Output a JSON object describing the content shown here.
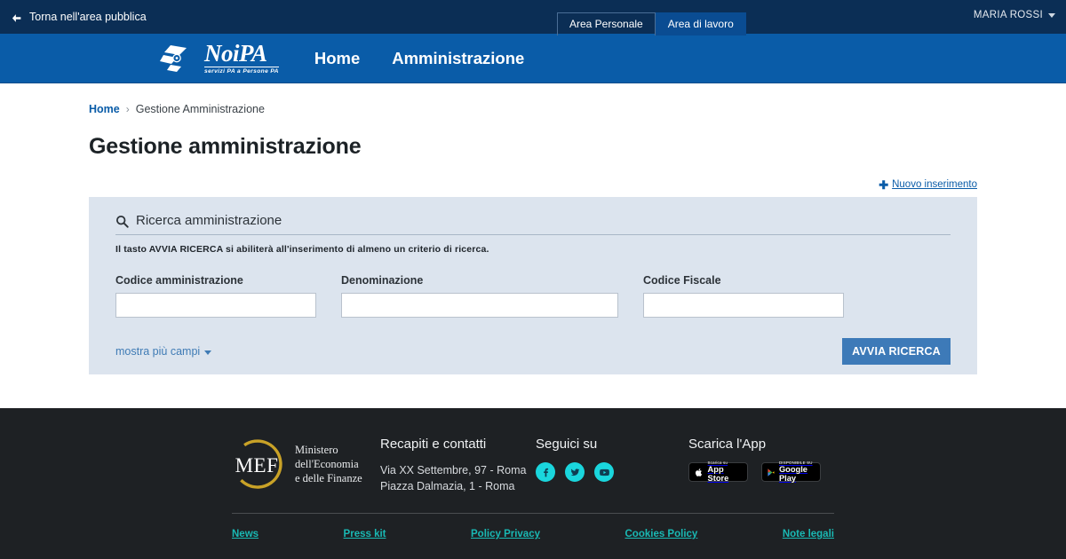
{
  "topbar": {
    "back_label": "Torna nell'area pubblica",
    "back_icon": "arrow-left-icon",
    "tabs": [
      {
        "label": "Area Personale",
        "active": false
      },
      {
        "label": "Area di lavoro",
        "active": true
      }
    ],
    "user": "MARIA ROSSI",
    "user_caret_icon": "chevron-down-icon",
    "bg_color": "#0b2e55"
  },
  "header": {
    "logo_text": "NoiPA",
    "logo_tagline": "servizi PA a Persone PA",
    "nav": [
      {
        "label": "Home"
      },
      {
        "label": "Amministrazione"
      }
    ],
    "bg_color": "#0a5ca8"
  },
  "breadcrumb": {
    "home": "Home",
    "separator": "›",
    "current": "Gestione Amministrazione"
  },
  "page": {
    "title": "Gestione amministrazione",
    "new_insert_label": "Nuovo inserimento",
    "new_insert_icon": "plus-icon"
  },
  "search_panel": {
    "search_icon": "search-icon",
    "title": "Ricerca amministrazione",
    "hint": "Il tasto AVVIA RICERCA si abiliterà all'inserimento di almeno un criterio di ricerca.",
    "fields": [
      {
        "label": "Codice amministrazione",
        "value": "",
        "placeholder": ""
      },
      {
        "label": "Denominazione",
        "value": "",
        "placeholder": ""
      },
      {
        "label": "Codice Fiscale",
        "value": "",
        "placeholder": ""
      }
    ],
    "more_fields_label": "mostra più campi",
    "more_fields_icon": "chevron-down-icon",
    "submit_label": "AVVIA RICERCA",
    "submit_color": "#3d7ab8",
    "bg_color": "#dce4ee"
  },
  "footer": {
    "bg_color": "#1e2124",
    "mef": {
      "mark": "MEF",
      "line1": "Ministero",
      "line2": "dell'Economia",
      "line3": "e delle Finanze"
    },
    "contacts": {
      "heading": "Recapiti e contatti",
      "lines": [
        "Via XX Settembre, 97 - Roma",
        "Piazza Dalmazia, 1 - Roma"
      ]
    },
    "social": {
      "heading": "Seguici su",
      "icons": [
        "facebook-icon",
        "twitter-icon",
        "youtube-icon"
      ],
      "color": "#1ad6dd"
    },
    "app": {
      "heading": "Scarica l'App",
      "badges": [
        {
          "icon": "apple-icon",
          "small": "Scarica su",
          "big": "App Store"
        },
        {
          "icon": "google-play-icon",
          "small": "DISPONIBILE SU",
          "big": "Google Play"
        }
      ]
    },
    "links": [
      {
        "label": "News"
      },
      {
        "label": "Press kit"
      },
      {
        "label": "Policy Privacy"
      },
      {
        "label": "Cookies Policy"
      },
      {
        "label": "Note legali"
      }
    ],
    "link_color": "#19b9b4"
  }
}
